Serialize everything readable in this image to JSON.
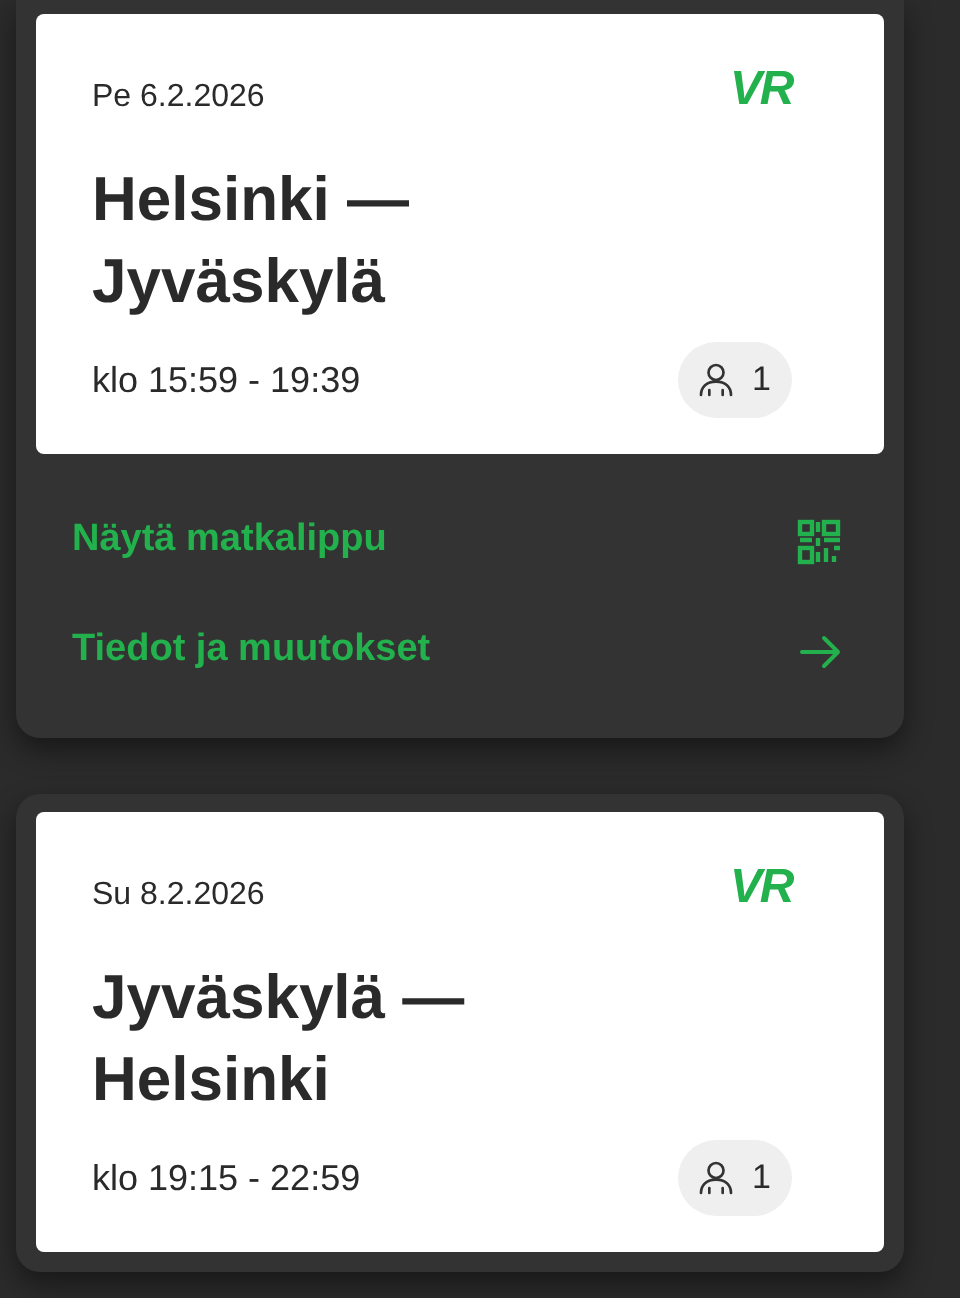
{
  "trips": [
    {
      "date": "Pe 6.2.2026",
      "logo": "VR",
      "route": "Helsinki — Jyväskylä",
      "time": "klo 15:59 - 19:39",
      "passengers": "1",
      "actions": [
        {
          "kind": "ticket",
          "label": "Näytä matkalippu"
        },
        {
          "kind": "details",
          "label": "Tiedot ja muutokset"
        }
      ]
    },
    {
      "date": "Su 8.2.2026",
      "logo": "VR",
      "route": "Jyväskylä — Helsinki",
      "time": "klo 19:15 - 22:59",
      "passengers": "1"
    }
  ]
}
